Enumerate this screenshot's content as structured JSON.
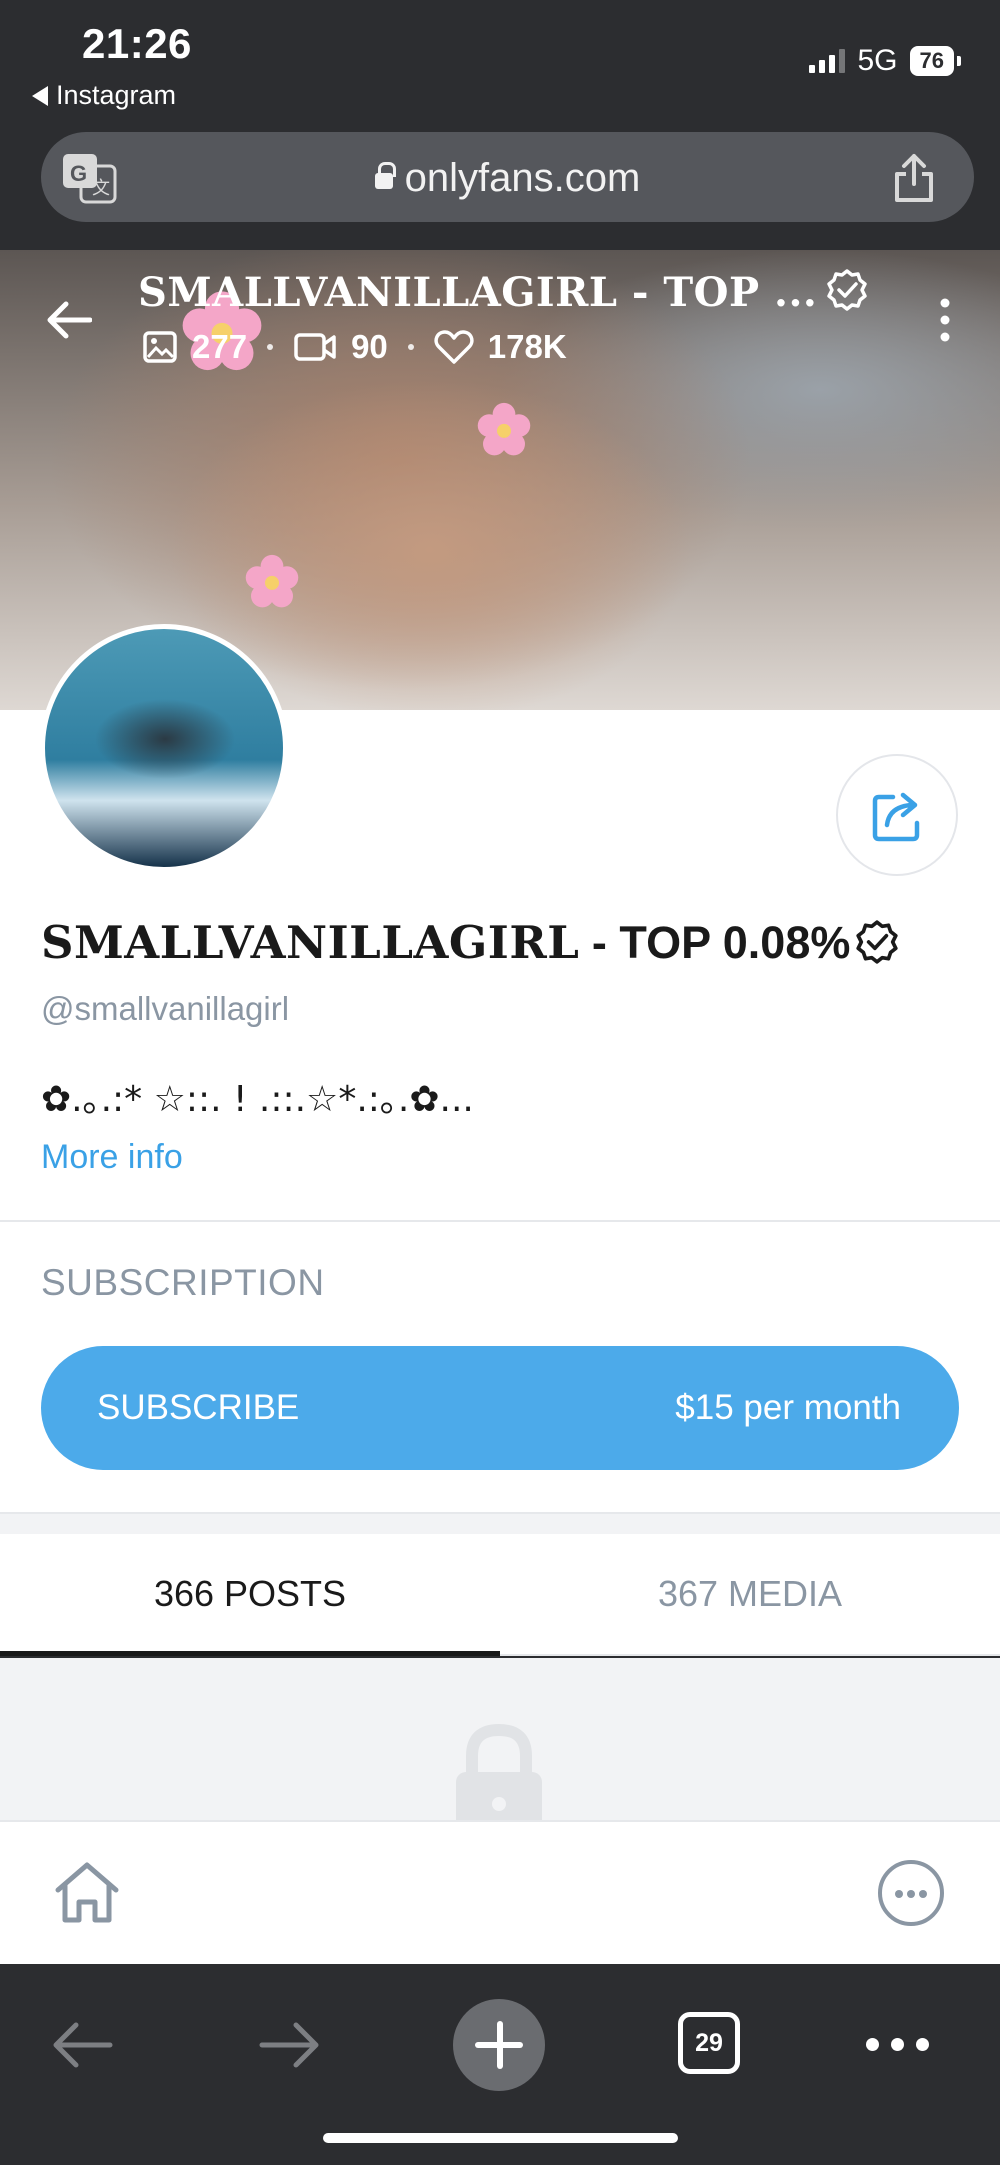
{
  "status_bar": {
    "time": "21:26",
    "back_app": "Instagram",
    "network": "5G",
    "battery": "76"
  },
  "browser": {
    "url": "onlyfans.com",
    "tab_count": "29",
    "icons": [
      "translate-icon",
      "lock-icon",
      "share-icon",
      "back-arrow-icon",
      "forward-arrow-icon",
      "new-tab-plus-icon",
      "tabs-icon",
      "more-dots-icon"
    ]
  },
  "cover": {
    "title": "SMALLVANILLAGIRL - TOP ...",
    "stats": {
      "photos": "277",
      "videos": "90",
      "likes": "178K"
    }
  },
  "profile": {
    "name_serif": "SMALLVANILLAGIRL",
    "name_rest": " - TOP 0.08%",
    "handle": "@smallvanillagirl",
    "bio": "✿.｡.:* ☆::. ! .::.☆*.:｡.✿...",
    "more_info": "More info"
  },
  "subscription": {
    "section_title": "SUBSCRIPTION",
    "button_label": "SUBSCRIBE",
    "price": "$15 per month"
  },
  "tabs": [
    {
      "label": "366 POSTS",
      "active": true
    },
    {
      "label": "367 MEDIA",
      "active": false
    }
  ],
  "colors": {
    "accent": "#4caaea",
    "link": "#3aa1e6",
    "muted": "#8a96a3",
    "chrome": "#2c2d30"
  }
}
